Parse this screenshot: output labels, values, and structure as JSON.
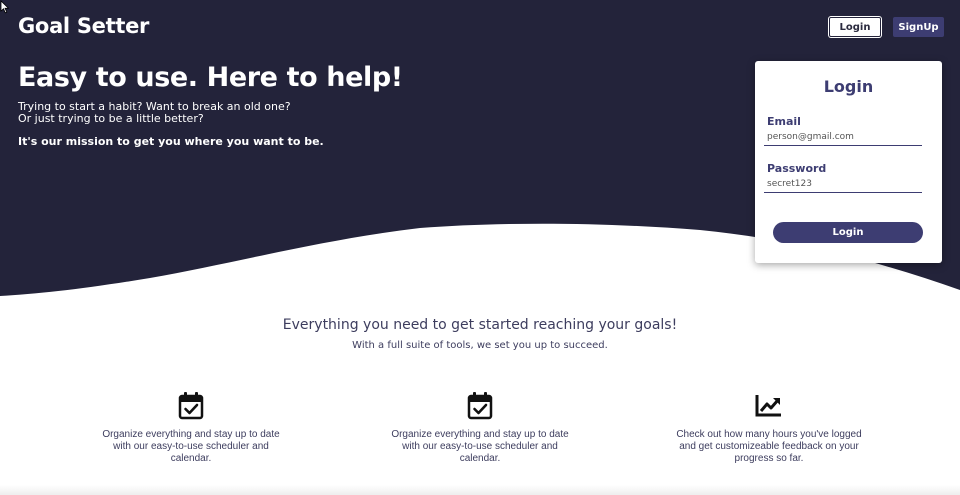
{
  "colors": {
    "hero_bg": "#23233a",
    "accent": "#3d3d72",
    "text_dark": "#3d3d5e",
    "white": "#ffffff"
  },
  "header": {
    "brand": "Goal Setter",
    "login_label": "Login",
    "signup_label": "SignUp"
  },
  "hero": {
    "headline": "Easy to use. Here to help!",
    "sub_line1": "Trying to start a habit? Want to break an old one?",
    "sub_line2": "Or just trying to be a little better?",
    "mission": "It's our mission to get you where you want to be."
  },
  "login_card": {
    "title": "Login",
    "email_label": "Email",
    "email_value": "person@gmail.com",
    "password_label": "Password",
    "password_value": "secret123",
    "submit_label": "Login"
  },
  "features_section": {
    "title": "Everything you need to get started reaching your goals!",
    "subtitle": "With a full suite of tools, we set you up to succeed.",
    "items": [
      {
        "icon": "calendar-check-icon",
        "text": "Organize everything and stay up to date with our easy-to-use scheduler and calendar."
      },
      {
        "icon": "calendar-check-icon",
        "text": "Organize everything and stay up to date with our easy-to-use scheduler and calendar."
      },
      {
        "icon": "chart-line-icon",
        "text": "Check out how many hours you've logged and get customizeable feedback on your progress so far."
      }
    ]
  }
}
